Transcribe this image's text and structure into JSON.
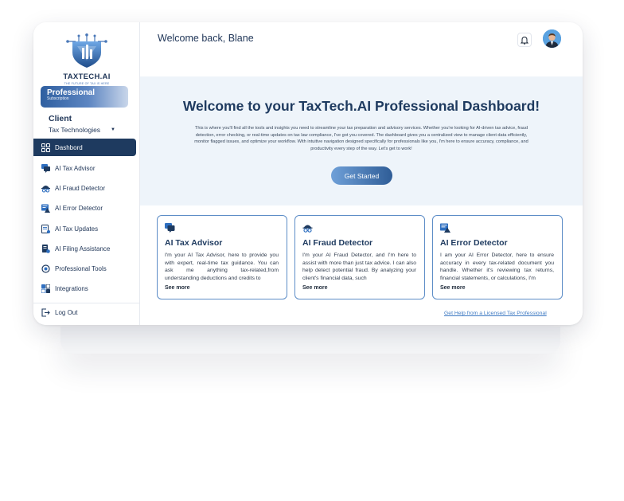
{
  "brand": {
    "name": "TAXTECH.AI",
    "tagline": "THE FUTURE OF TAX IS HERE"
  },
  "subscription": {
    "plan": "Professional",
    "caption": "Subscription"
  },
  "client": {
    "label": "Client",
    "selected": "Tax Technologies"
  },
  "sidebar": {
    "items": [
      {
        "label": "Dashbord",
        "icon": "dashboard-icon",
        "active": true
      },
      {
        "label": "AI Tax Advisor",
        "icon": "chat-icon"
      },
      {
        "label": "AI Fraud Detector",
        "icon": "detective-icon"
      },
      {
        "label": "AI Error Detector",
        "icon": "alert-doc-icon"
      },
      {
        "label": "AI Tax Updates",
        "icon": "updates-icon"
      },
      {
        "label": "AI Filing Assistance",
        "icon": "filing-icon"
      },
      {
        "label": "Professional Tools",
        "icon": "tools-icon"
      },
      {
        "label": "Integrations",
        "icon": "integrations-icon"
      }
    ],
    "logout": "Log Out"
  },
  "header": {
    "welcome": "Welcome back, Blane"
  },
  "hero": {
    "title": "Welcome to your TaxTech.AI Professional Dashboard!",
    "description": "This is where you'll find all the tools and insights you need to streamline your tax preparation and advisory services. Whether you're looking for AI-driven tax advice, fraud detection, error checking, or real-time updates on tax law compliance, I've got you covered. The dashboard gives you a centralized view to manage client data efficiently, monitor flagged issues, and optimize your workflow. With intuitive navigation designed specifically for professionals like you, I'm here to ensure accuracy, compliance, and productivity every step of the way. Let's get to work!",
    "cta": "Get Started"
  },
  "cards": [
    {
      "title": "AI Tax Advisor",
      "icon": "chat-icon",
      "body": "I'm your AI Tax Advisor, here to provide you with expert, real-time tax guidance. You can ask me anything tax-related,from understanding deductions and credits to",
      "more": "See more"
    },
    {
      "title": "AI Fraud Detector",
      "icon": "detective-icon",
      "body": "I'm your AI Fraud Detector, and I'm here to assist with more than just tax advice. I can also help detect potential fraud. By analyzing your client's financial data, such",
      "more": "See more"
    },
    {
      "title": "AI Error Detector",
      "icon": "alert-doc-icon",
      "body": "I am your AI Error Detector, here to ensure accuracy in every tax-related document you handle.  Whether it's reviewing tax returns, financial statements, or calculations, I'm",
      "more": "See more"
    }
  ],
  "help_link": "Get Help from a Licensed Tax Professional",
  "colors": {
    "navy": "#1e3a5f",
    "accent_blue": "#3d79c2",
    "hero_bg": "#eef4fa",
    "card_border": "#5d8dc7"
  }
}
